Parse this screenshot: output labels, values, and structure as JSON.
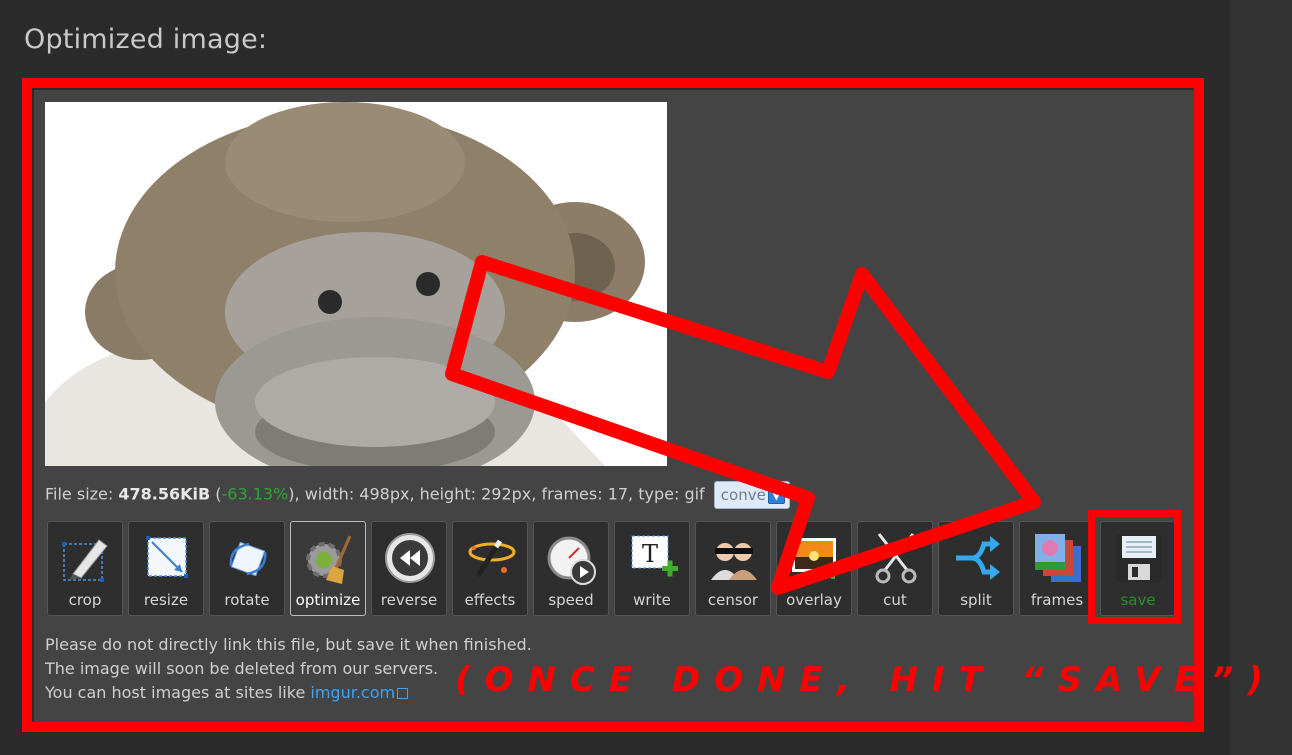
{
  "heading": "Optimized image:",
  "file_info": {
    "prefix": "File size: ",
    "size": "478.56KiB",
    "open_paren": " (",
    "percent": "-63.13%",
    "rest": "), width: 498px, height: 292px, frames: 17, type: gif",
    "convert_label": "conve"
  },
  "tools": [
    {
      "label": "crop",
      "icon": "crop-icon"
    },
    {
      "label": "resize",
      "icon": "resize-icon"
    },
    {
      "label": "rotate",
      "icon": "rotate-icon"
    },
    {
      "label": "optimize",
      "icon": "optimize-icon",
      "active": true
    },
    {
      "label": "reverse",
      "icon": "reverse-icon"
    },
    {
      "label": "effects",
      "icon": "effects-icon"
    },
    {
      "label": "speed",
      "icon": "speed-icon"
    },
    {
      "label": "write",
      "icon": "write-icon"
    },
    {
      "label": "censor",
      "icon": "censor-icon"
    },
    {
      "label": "overlay",
      "icon": "overlay-icon"
    },
    {
      "label": "cut",
      "icon": "cut-icon"
    },
    {
      "label": "split",
      "icon": "split-icon"
    },
    {
      "label": "frames",
      "icon": "frames-icon"
    },
    {
      "label": "save",
      "icon": "save-icon"
    }
  ],
  "notes": {
    "line1": "Please do not directly link this file, but save it when finished.",
    "line2": "The image will soon be deleted from our servers.",
    "line3_prefix": "You can host images at sites like ",
    "line3_link": "imgur.com"
  },
  "annotation": "(ONCE DONE, HIT “SAVE”)",
  "colors": {
    "annotation_red": "#ff0000",
    "percent_green": "#2fa52f",
    "link_blue": "#3ba5f5",
    "panel_bg": "#444444",
    "page_bg": "#2b2b2b"
  }
}
